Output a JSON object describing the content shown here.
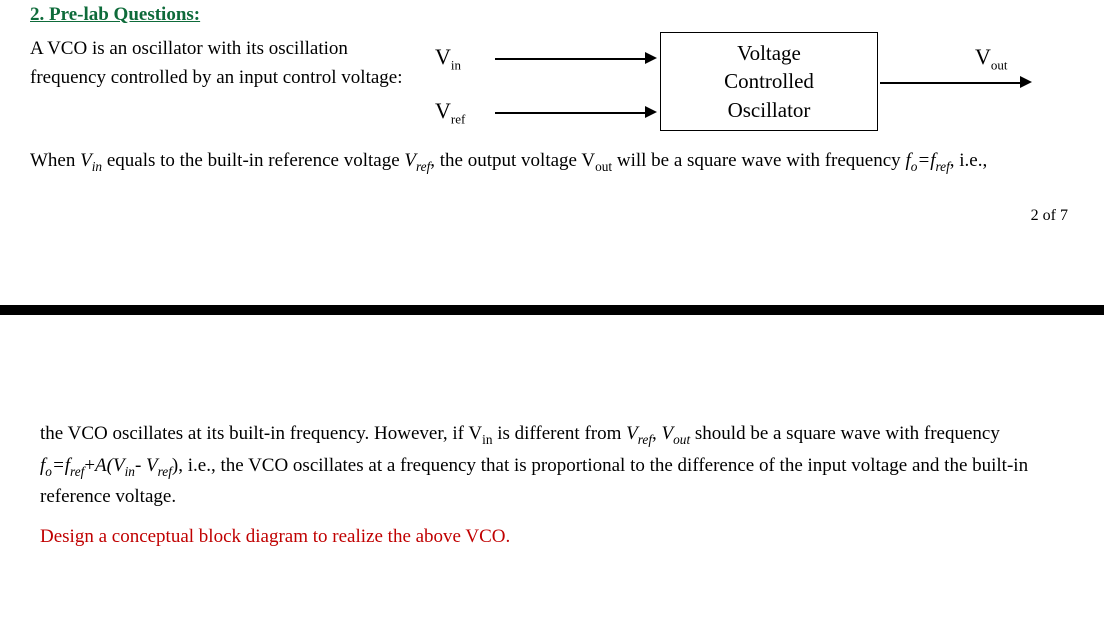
{
  "heading": "2. Pre-lab Questions:",
  "intro": "A VCO is an oscillator with its oscillation frequency controlled by an input control voltage:",
  "diagram": {
    "vin": "V",
    "vin_sub": "in",
    "vref": "V",
    "vref_sub": "ref",
    "vout": "V",
    "vout_sub": "out",
    "box_line1": "Voltage",
    "box_line2": "Controlled",
    "box_line3": "Oscillator"
  },
  "para1_a": "When ",
  "para1_b": " equals to the built-in reference voltage ",
  "para1_c": ", the output voltage V",
  "para1_d": " will be a square wave with frequency ",
  "para1_e": ", i.e.,",
  "vin_it": "V",
  "vin_it_sub": "in",
  "vref_it": "V",
  "vref_it_sub": "ref",
  "vout_sub_txt": "out",
  "fo": "f",
  "fo_sub": "o",
  "eq1": "=",
  "fref": "f",
  "fref_sub": "ref",
  "page_num": "2 of 7",
  "para2_a": "the VCO oscillates at its built-in frequency. However, if V",
  "para2_b": " is different from ",
  "para2_c": ", ",
  "para2_d": " should be a square wave with frequency ",
  "para2_e": "+",
  "para2_f": "A(V",
  "para2_g": "- ",
  "para2_h": "), i.e., the VCO oscillates at a frequency that is proportional to the difference of the input voltage and the built-in reference voltage.",
  "in_sub": "in",
  "vout_it": "V",
  "vout_it_sub": "out",
  "red": "Design a conceptual block diagram to realize the above VCO."
}
